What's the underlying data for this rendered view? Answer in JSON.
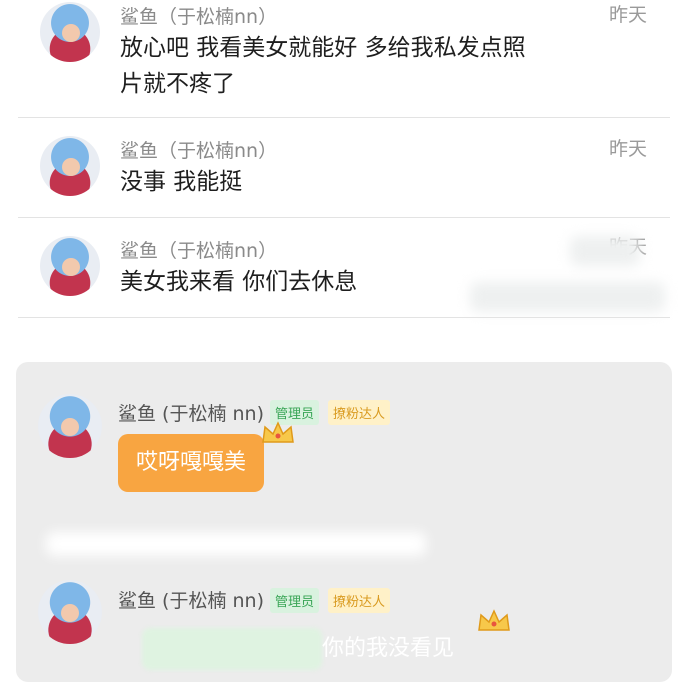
{
  "comments": [
    {
      "name": "鲨鱼（于松楠nn）",
      "time": "昨天",
      "text_line1": "放心吧 我看美女就能好 多给我私发点照",
      "text_line2": "片就不疼了"
    },
    {
      "name": "鲨鱼（于松楠nn）",
      "time": "昨天",
      "text_line1": "没事 我能挺"
    },
    {
      "name": "鲨鱼（于松楠nn）",
      "time": "昨天",
      "text_line1": "美女我来看 你们去休息"
    }
  ],
  "chat": {
    "messages": [
      {
        "name": "鲨鱼 (于松楠 nn)",
        "badge_admin": "管理员",
        "badge_fan": "撩粉达人",
        "text": "哎呀嘎嘎美"
      },
      {
        "name": "鲨鱼 (于松楠 nn)",
        "badge_admin": "管理员",
        "badge_fan": "撩粉达人",
        "text": "你的我没看见"
      }
    ],
    "bubble_color": "#f8a541",
    "panel_color": "#ececec"
  }
}
